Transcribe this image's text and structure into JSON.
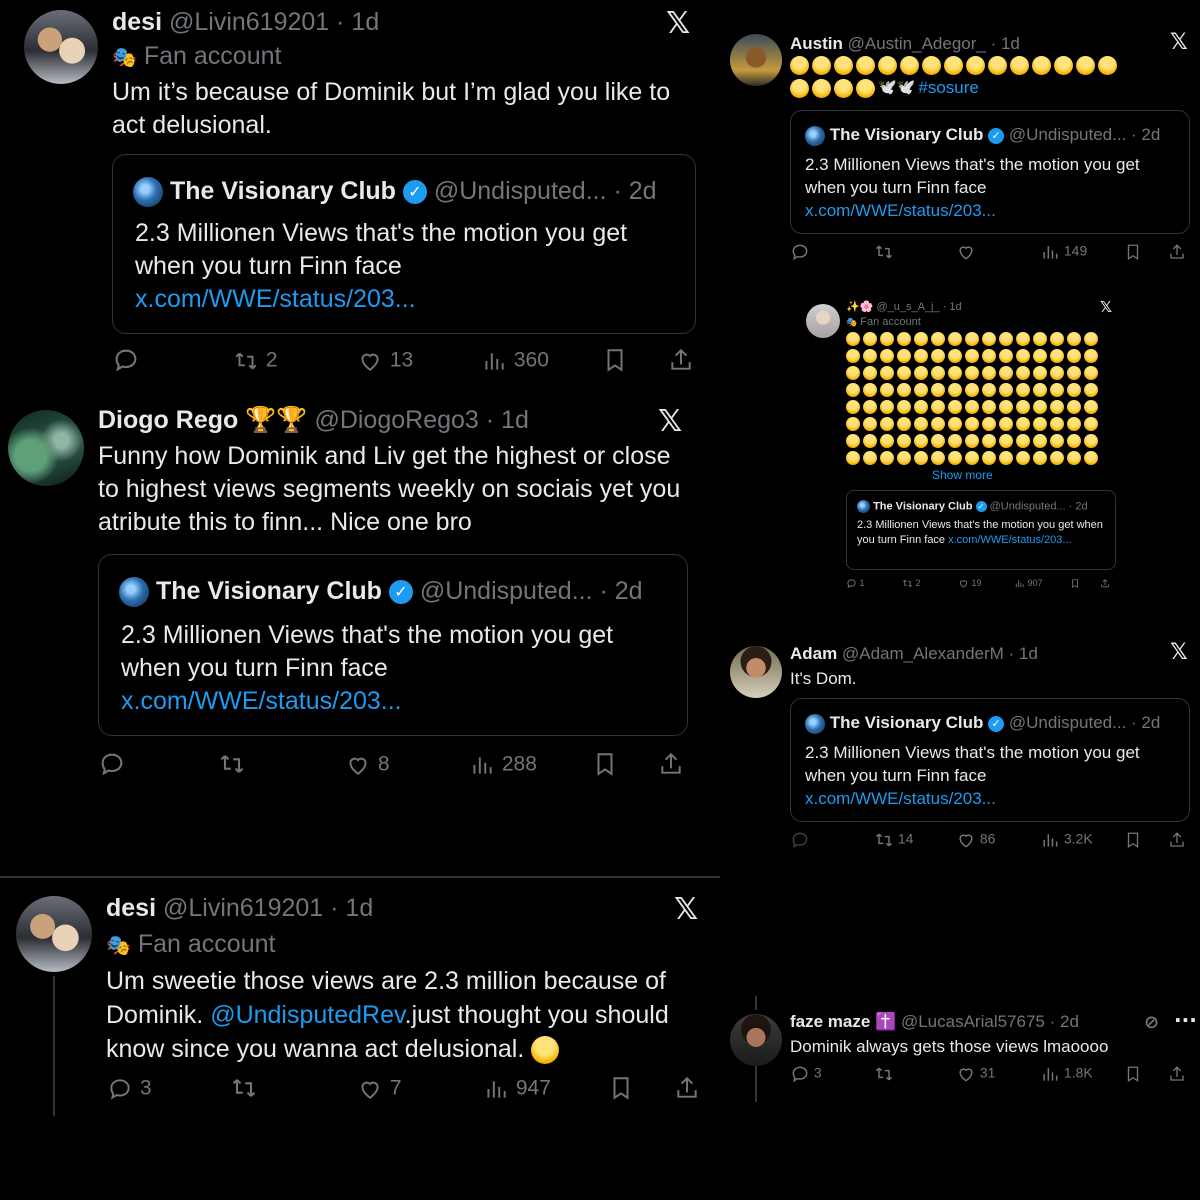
{
  "left": {
    "t1": {
      "name": "desi",
      "handle": "@Livin619201",
      "time": "· 1d",
      "fan_label": "Fan account",
      "text": "Um it’s because of Dominik but I’m glad you like to act delusional.",
      "quote": {
        "name": "The Visionary Club",
        "handle": "@Undisputed...",
        "time": "· 2d",
        "text": "2.3 Millionen Views that's the motion you get when you turn Finn face ",
        "link": "x.com/WWE/status/203..."
      },
      "actions": {
        "reply": "",
        "retweet": "2",
        "like": "13",
        "views": "360"
      }
    },
    "t2": {
      "name": "Diogo Rego",
      "handle": "@DiogoRego3",
      "time": "· 1d",
      "text": "Funny how Dominik and Liv get the highest or close to highest views segments weekly on sociais yet you atribute this to finn... Nice one bro",
      "quote": {
        "name": "The Visionary Club",
        "handle": "@Undisputed...",
        "time": "· 2d",
        "text": "2.3 Millionen Views that's the motion you get when you turn Finn face ",
        "link": "x.com/WWE/status/203..."
      },
      "actions": {
        "reply": "",
        "retweet": "",
        "like": "8",
        "views": "288"
      }
    },
    "t3": {
      "name": "desi",
      "handle": "@Livin619201",
      "time": "· 1d",
      "fan_label": "Fan account",
      "text_a": "Um sweetie those views are 2.3 million because of Dominik. ",
      "mention": "@UndisputedRev",
      "text_b": ".just thought you should know since you wanna act delusional.",
      "actions": {
        "reply": "3",
        "retweet": "",
        "like": "7",
        "views": "947"
      }
    }
  },
  "right": {
    "t1": {
      "name": "Austin",
      "handle": "@Austin_Adegor_",
      "time": "· 1d",
      "hashtag": "#sosure",
      "quote": {
        "name": "The Visionary Club",
        "handle": "@Undisputed...",
        "time": "· 2d",
        "text": "2.3 Millionen Views that's the motion you get when you turn Finn face ",
        "link": "x.com/WWE/status/203..."
      },
      "actions": {
        "reply": "",
        "retweet": "",
        "like": "",
        "views": "149"
      }
    },
    "t2": {
      "name": "✨🌸",
      "handle": "@_u_s_A_j_",
      "time": "· 1d",
      "fan_label": "Fan account",
      "show_more": "Show more",
      "quote": {
        "name": "The Visionary Club",
        "handle": "@Undisputed...",
        "time": "· 2d",
        "text": "2.3 Millionen Views that's the motion you get when you turn Finn face ",
        "link": "x.com/WWE/status/203..."
      },
      "actions": {
        "reply": "1",
        "retweet": "2",
        "like": "19",
        "views": "907"
      }
    },
    "t3": {
      "name": "Adam",
      "handle": "@Adam_AlexanderM",
      "time": "· 1d",
      "text": "It's Dom.",
      "quote": {
        "name": "The Visionary Club",
        "handle": "@Undisputed...",
        "time": "· 2d",
        "text": "2.3 Millionen Views that's the motion you get when you turn Finn face ",
        "link": "x.com/WWE/status/203..."
      },
      "actions": {
        "reply": "",
        "retweet": "14",
        "like": "86",
        "views": "3.2K"
      }
    },
    "t4": {
      "name": "faze maze",
      "badge": "✝️",
      "handle": "@LucasArial57675",
      "time": "· 2d",
      "text": "Dominik always gets those views lmaoooo",
      "actions": {
        "reply": "3",
        "retweet": "",
        "like": "31",
        "views": "1.8K"
      }
    }
  },
  "icons": {
    "x_logo": "𝕏",
    "reply": "💬",
    "retweet": "⟲",
    "like": "♡",
    "views": "📊",
    "bookmark": "🔖",
    "share": "⇧",
    "verified": "✓",
    "fan_mask": "🎭",
    "grok": "⊘"
  },
  "colors": {
    "background": "#000000",
    "text": "#e7e9ea",
    "muted": "#71767b",
    "link": "#1d9bf0",
    "border": "#2f3336"
  }
}
